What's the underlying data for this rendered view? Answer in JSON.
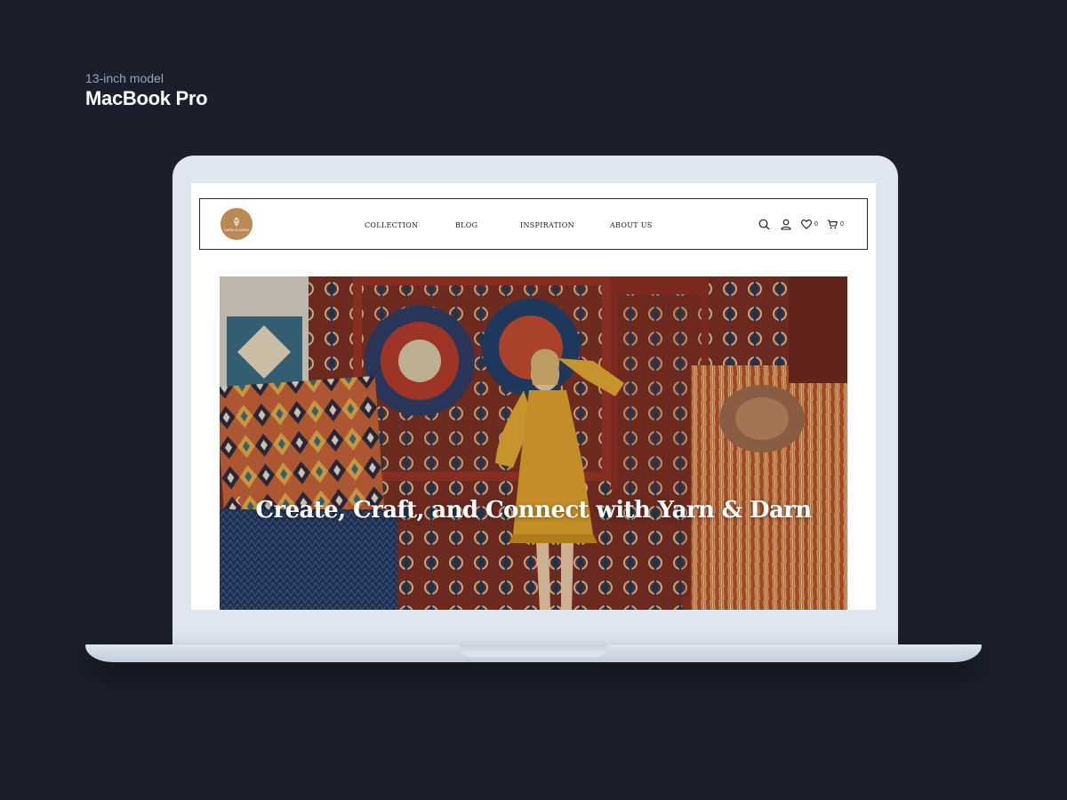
{
  "caption": {
    "subtitle": "13-inch model",
    "title": "MacBook Pro"
  },
  "site": {
    "logo_text": "YARN & DARN",
    "nav": [
      {
        "label": "COLLECTION"
      },
      {
        "label": "BLOG"
      },
      {
        "label": "INSPIRATION"
      },
      {
        "label": "ABOUT US"
      }
    ],
    "wishlist_count": "0",
    "cart_count": "0",
    "colors": {
      "logo": "#b98a54",
      "text": "#1c1c1c"
    }
  },
  "hero": {
    "heading": "Create, Craft, and Connect with Yarn & Darn",
    "prev_icon": "chevron-left-icon"
  },
  "icons": {
    "search": "search-icon",
    "account": "user-icon",
    "wishlist": "heart-icon",
    "cart": "cart-icon"
  }
}
